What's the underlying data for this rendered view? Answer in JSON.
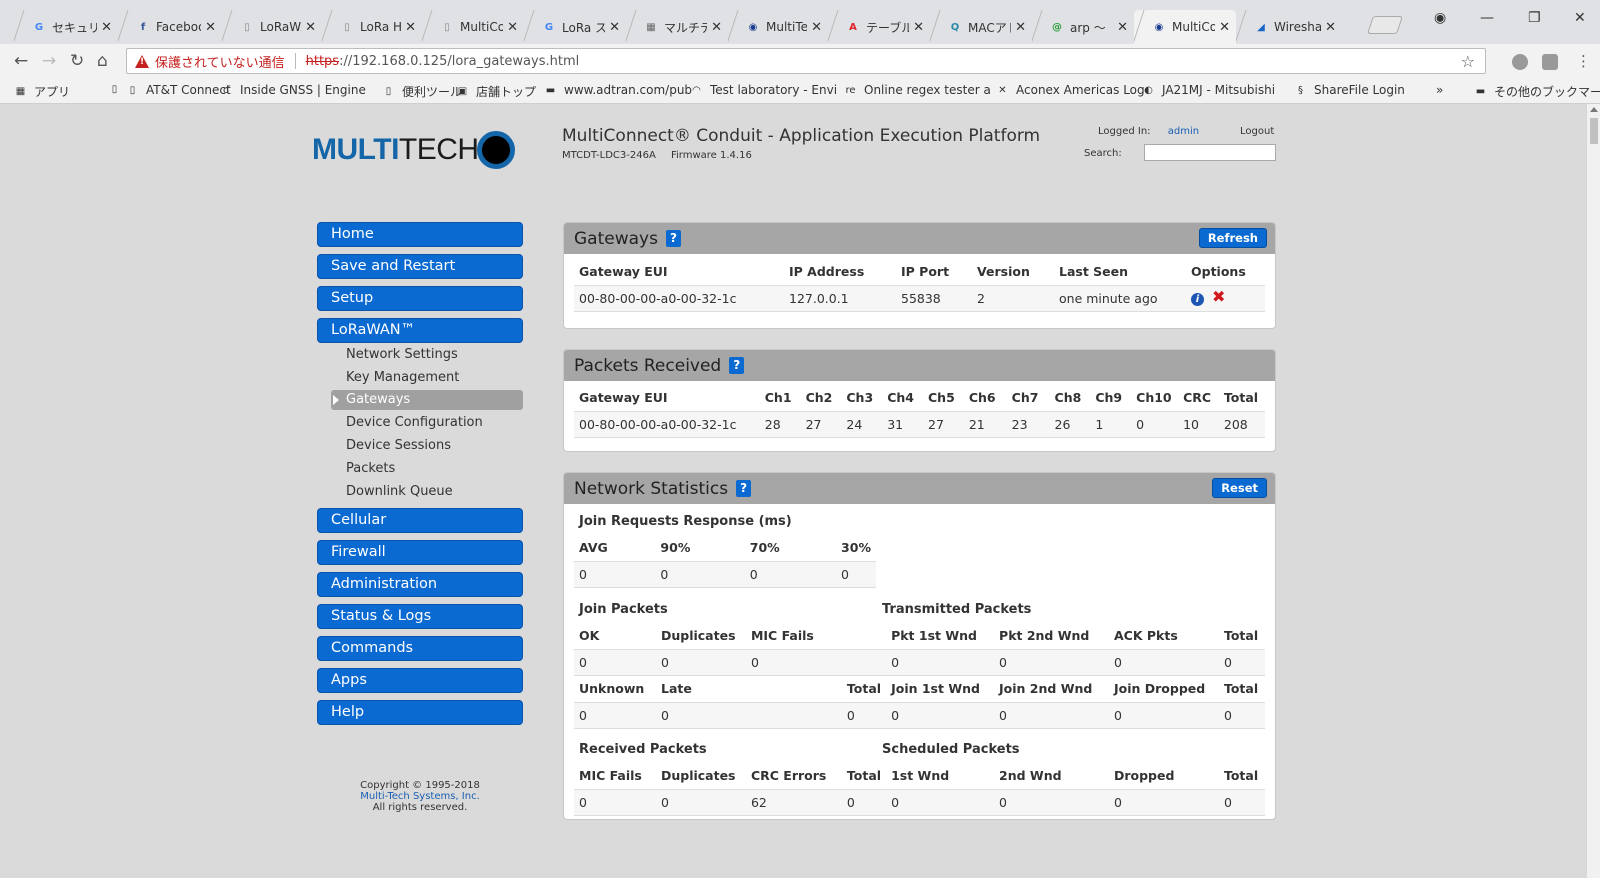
{
  "browser": {
    "tabs": [
      {
        "label": "セキュリテ",
        "icon": "G",
        "color": "#4285f4"
      },
      {
        "label": "Faceboo",
        "icon": "f",
        "color": "#3b5998"
      },
      {
        "label": "LoRaWA",
        "icon": "",
        "color": "#888"
      },
      {
        "label": "LoRa Hu",
        "icon": "",
        "color": "#888"
      },
      {
        "label": "MultiCo",
        "icon": "",
        "color": "#888"
      },
      {
        "label": "LoRa ス",
        "icon": "G",
        "color": "#4285f4"
      },
      {
        "label": "マルチテ",
        "icon": "▦",
        "color": "#666"
      },
      {
        "label": "MultiTec",
        "icon": "◉",
        "color": "#1a3d8f"
      },
      {
        "label": "テーブルを",
        "icon": "A",
        "color": "#e0242b"
      },
      {
        "label": "MACアド",
        "icon": "Q",
        "color": "#2a8aa3"
      },
      {
        "label": "arp ～",
        "icon": "@",
        "color": "#2a9d3a"
      },
      {
        "label": "MultiCo",
        "icon": "◉",
        "color": "#1a3d8f"
      },
      {
        "label": "Wiresha",
        "icon": "◢",
        "color": "#1a66c4"
      }
    ],
    "address": {
      "warning": "保護されていない通信",
      "protocol": "https",
      "rest": "://192.168.0.125/lora_gateways.html"
    },
    "bookmarks": [
      {
        "label": "アプリ",
        "icon": "▦"
      },
      {
        "label": "",
        "icon": "▯"
      },
      {
        "label": "AT&T Connect",
        "icon": "▯"
      },
      {
        "label": "Inside GNSS | Engine",
        "icon": "ʛ"
      },
      {
        "label": "便利ツール",
        "icon": "▯"
      },
      {
        "label": "店舗トップ",
        "icon": "▣"
      },
      {
        "label": "www.adtran.com/pub",
        "icon": "▬"
      },
      {
        "label": "Test laboratory - Envi",
        "icon": "◠"
      },
      {
        "label": "Online regex tester a",
        "icon": "re"
      },
      {
        "label": "Aconex Americas Log",
        "icon": "✕"
      },
      {
        "label": "JA21MJ - Mitsubishi",
        "icon": "◐"
      },
      {
        "label": "ShareFile Login",
        "icon": "§"
      },
      {
        "label": "»",
        "icon": ""
      },
      {
        "label": "その他のブックマーク",
        "icon": "▬"
      }
    ],
    "colors": {
      "blue": "#0a6ad1",
      "danger": "#c5221f"
    }
  },
  "header": {
    "logo_left": "MULTI",
    "logo_right": "TECH",
    "title": "MultiConnect® Conduit - Application Execution Platform",
    "model": "MTCDT-LDC3-246A",
    "firmware": "Firmware 1.4.16",
    "logged_in_label": "Logged In:",
    "user": "admin",
    "logout": "Logout",
    "search_label": "Search:"
  },
  "sidebar": {
    "items": [
      "Home",
      "Save and Restart",
      "Setup",
      "LoRaWAN™",
      "Cellular",
      "Firewall",
      "Administration",
      "Status & Logs",
      "Commands",
      "Apps",
      "Help"
    ],
    "sub_items": [
      "Network Settings",
      "Key Management",
      "Gateways",
      "Device Configuration",
      "Device Sessions",
      "Packets",
      "Downlink Queue"
    ],
    "active_sub": "Gateways",
    "copyright_line1": "Copyright © 1995-2018",
    "copyright_link": "Multi-Tech Systems, Inc.",
    "copyright_line3": "All rights reserved."
  },
  "gateways": {
    "title": "Gateways",
    "refresh_label": "Refresh",
    "headers": [
      "Gateway EUI",
      "IP Address",
      "IP Port",
      "Version",
      "Last Seen",
      "Options"
    ],
    "rows": [
      [
        "00-80-00-00-a0-00-32-1c",
        "127.0.0.1",
        "55838",
        "2",
        "one minute ago"
      ]
    ]
  },
  "packets_received": {
    "title": "Packets Received",
    "headers": [
      "Gateway EUI",
      "Ch1",
      "Ch2",
      "Ch3",
      "Ch4",
      "Ch5",
      "Ch6",
      "Ch7",
      "Ch8",
      "Ch9",
      "Ch10",
      "CRC",
      "Total"
    ],
    "rows": [
      [
        "00-80-00-00-a0-00-32-1c",
        "28",
        "27",
        "24",
        "31",
        "27",
        "21",
        "23",
        "26",
        "1",
        "0",
        "10",
        "208"
      ]
    ]
  },
  "network_stats": {
    "title": "Network Statistics",
    "reset_label": "Reset",
    "join_response": {
      "title": "Join Requests Response (ms)",
      "headers": [
        "AVG",
        "90%",
        "70%",
        "30%"
      ],
      "values": [
        "0",
        "0",
        "0",
        "0"
      ]
    },
    "join_packets": {
      "title": "Join Packets",
      "headers": [
        "OK",
        "Duplicates",
        "MIC Fails",
        ""
      ],
      "values": [
        "0",
        "0",
        "0",
        ""
      ],
      "headers2": [
        "Unknown",
        "Late",
        "",
        "Total"
      ],
      "values2": [
        "0",
        "0",
        "",
        "0"
      ]
    },
    "transmitted": {
      "title": "Transmitted Packets",
      "headers": [
        "Pkt 1st Wnd",
        "Pkt 2nd Wnd",
        "ACK Pkts",
        "Total"
      ],
      "values": [
        "0",
        "0",
        "0",
        "0"
      ],
      "headers2": [
        "Join 1st Wnd",
        "Join 2nd Wnd",
        "Join Dropped",
        "Total"
      ],
      "values2": [
        "0",
        "0",
        "0",
        "0"
      ]
    },
    "received": {
      "title": "Received Packets",
      "headers": [
        "MIC Fails",
        "Duplicates",
        "CRC Errors",
        "Total"
      ],
      "values": [
        "0",
        "0",
        "62",
        "0"
      ]
    },
    "scheduled": {
      "title": "Scheduled Packets",
      "headers": [
        "1st Wnd",
        "2nd Wnd",
        "Dropped",
        "Total"
      ],
      "values": [
        "0",
        "0",
        "0",
        "0"
      ]
    }
  }
}
